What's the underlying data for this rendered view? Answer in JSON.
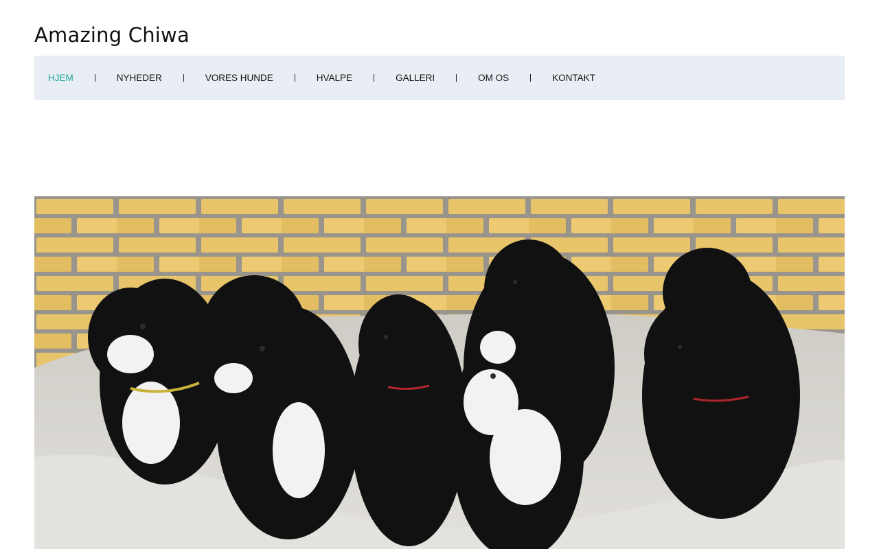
{
  "site": {
    "title": "Amazing Chiwa"
  },
  "nav": {
    "items": [
      {
        "label": "HJEM",
        "active": true
      },
      {
        "label": "NYHEDER",
        "active": false
      },
      {
        "label": "VORES HUNDE",
        "active": false
      },
      {
        "label": "HVALPE",
        "active": false
      },
      {
        "label": "GALLERI",
        "active": false
      },
      {
        "label": "OM OS",
        "active": false
      },
      {
        "label": "KONTAKT",
        "active": false
      }
    ]
  },
  "colors": {
    "accent": "#1aa39a",
    "nav_background": "#e9eef4",
    "text": "#111111"
  }
}
